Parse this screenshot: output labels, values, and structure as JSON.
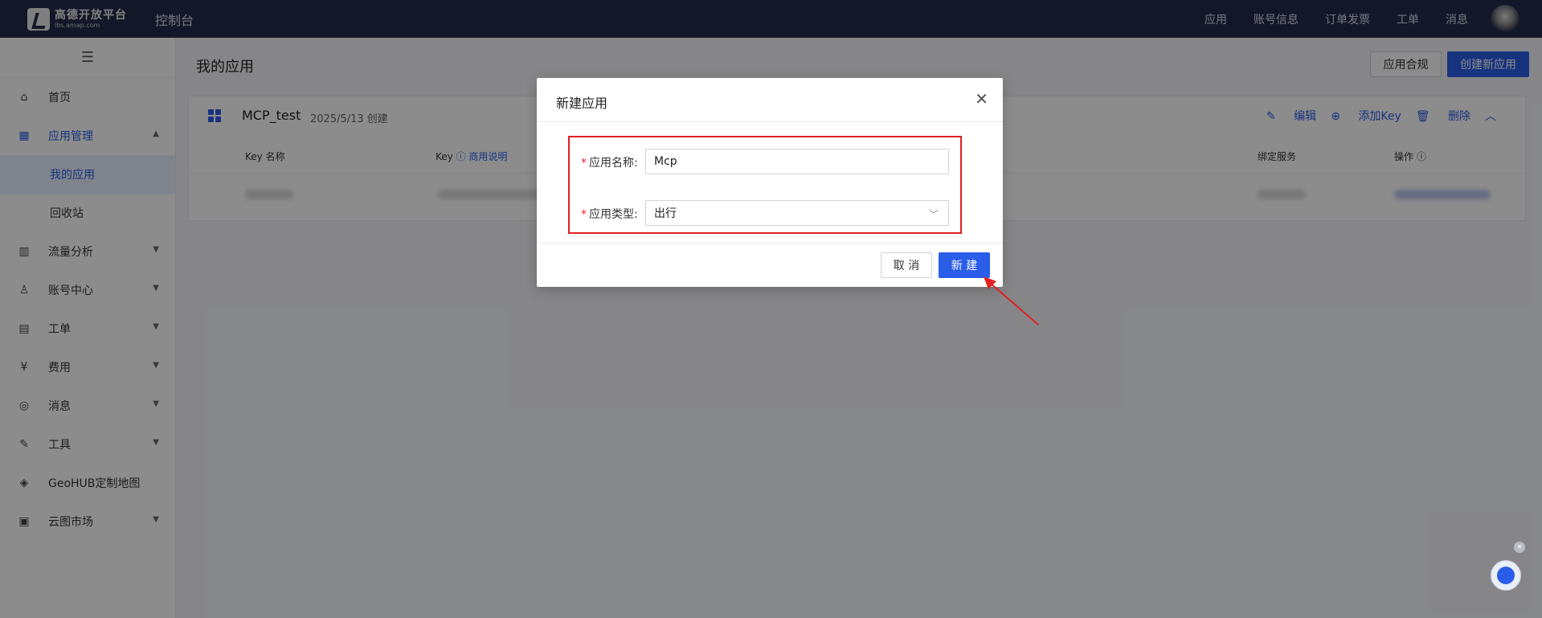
{
  "header": {
    "logo_text": "高德开放平台",
    "logo_sub": "lbs.amap.com",
    "console_title": "控制台",
    "nav": [
      "应用",
      "账号信息",
      "订单发票",
      "工单",
      "消息"
    ]
  },
  "sidebar": {
    "toggle_icon": "hamburger-icon",
    "items": [
      {
        "label": "首页",
        "icon": "home-icon"
      },
      {
        "label": "应用管理",
        "icon": "apps-icon",
        "expanded": true
      },
      {
        "label": "流量分析",
        "icon": "chart-icon"
      },
      {
        "label": "账号中心",
        "icon": "user-icon"
      },
      {
        "label": "工单",
        "icon": "ticket-icon"
      },
      {
        "label": "费用",
        "icon": "billing-icon"
      },
      {
        "label": "消息",
        "icon": "message-icon"
      },
      {
        "label": "工具",
        "icon": "wrench-icon"
      },
      {
        "label": "GeoHUB定制地图",
        "icon": "layers-icon"
      },
      {
        "label": "云图市场",
        "icon": "store-icon"
      }
    ],
    "subitems": [
      {
        "label": "我的应用",
        "selected": true
      },
      {
        "label": "回收站"
      }
    ]
  },
  "main": {
    "page_title": "我的应用",
    "btn_compliance": "应用合规",
    "btn_create": "创建新应用",
    "app_card": {
      "name": "MCP_test",
      "created": "2025/5/13 创建",
      "actions": [
        "编辑",
        "添加Key",
        "删除"
      ],
      "columns": {
        "key_name": "Key 名称",
        "key": "Key",
        "key_link": "商用说明",
        "bound_service": "绑定服务",
        "operation": "操作"
      }
    }
  },
  "modal": {
    "title": "新建应用",
    "name_label": "应用名称:",
    "name_value": "Mcp",
    "type_label": "应用类型:",
    "type_value": "出行",
    "cancel": "取 消",
    "confirm": "新 建"
  },
  "colors": {
    "accent": "#2a5de8",
    "topbar": "#252a4a",
    "highlight": "#e02020"
  }
}
